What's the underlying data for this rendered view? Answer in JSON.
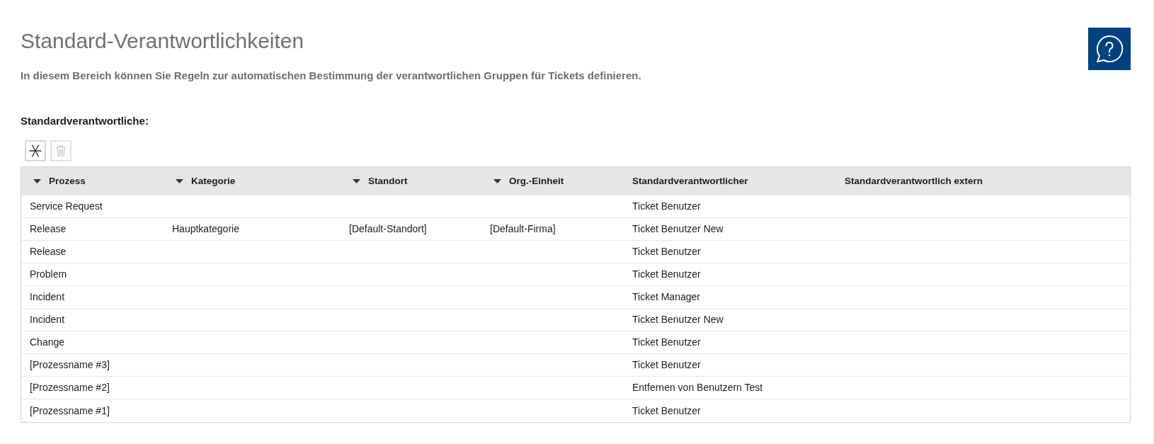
{
  "page": {
    "title": "Standard-Verantwortlichkeiten",
    "description": "In diesem Bereich können Sie Regeln zur automatischen Bestimmung der verantwortlichen Gruppen für Tickets definieren."
  },
  "section": {
    "title": "Standardverantwortliche:",
    "toolbar": [
      {
        "kind": "add",
        "disabled": false
      },
      {
        "kind": "delete",
        "disabled": true
      }
    ]
  },
  "table": {
    "columns": [
      {
        "label": "Prozess",
        "sortable": true
      },
      {
        "label": "Kategorie",
        "sortable": true
      },
      {
        "label": "Standort",
        "sortable": true
      },
      {
        "label": "Org.-Einheit",
        "sortable": true
      },
      {
        "label": "Standardverantwortlicher",
        "sortable": false
      },
      {
        "label": "Standardverantwortlich extern",
        "sortable": false
      }
    ],
    "rows": [
      {
        "prozess": "Service Request",
        "standardverantwortlicher": "Ticket Benutzer"
      },
      {
        "prozess": "Release",
        "kategorie": "Hauptkategorie",
        "standort": "[Default-Standort]",
        "org_einheit": "[Default-Firma]",
        "standardverantwortlicher": "Ticket Benutzer New"
      },
      {
        "prozess": "Release",
        "standardverantwortlicher": "Ticket Benutzer"
      },
      {
        "prozess": "Problem",
        "standardverantwortlicher": "Ticket Benutzer"
      },
      {
        "prozess": "Incident",
        "standardverantwortlicher": "Ticket Manager"
      },
      {
        "prozess": "Incident",
        "standardverantwortlicher": "Ticket Benutzer New"
      },
      {
        "prozess": "Change",
        "standardverantwortlicher": "Ticket Benutzer"
      },
      {
        "prozess": "[Prozessname #3]",
        "standardverantwortlicher": "Ticket Benutzer"
      },
      {
        "prozess": "[Prozessname #2]",
        "standardverantwortlicher": "Entfernen von Benutzern Test"
      },
      {
        "prozess": "[Prozessname #1]",
        "standardverantwortlicher": "Ticket Benutzer"
      }
    ]
  }
}
